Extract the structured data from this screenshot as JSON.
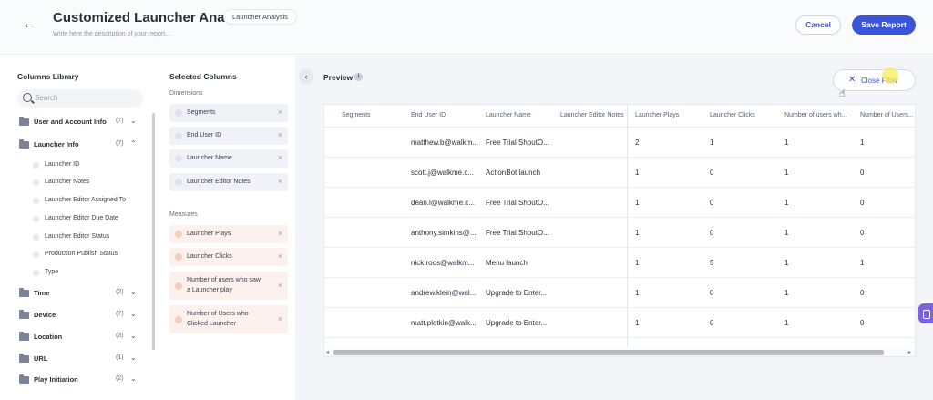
{
  "header": {
    "title": "Customized Launcher Analysis",
    "badge": "Launcher Analysis",
    "description_placeholder": "Write here the description of your report...",
    "cancel_label": "Cancel",
    "save_label": "Save Report",
    "accent_color": "#3b55d9"
  },
  "library": {
    "title": "Columns Library",
    "search_placeholder": "Search",
    "categories": [
      {
        "label": "User and Account Info",
        "count": "(7)",
        "chevron": "⌄"
      },
      {
        "label": "Launcher Info",
        "count": "(7)",
        "chevron": "⌃"
      },
      {
        "label": "Time",
        "count": "(2)",
        "chevron": "⌄"
      },
      {
        "label": "Device",
        "count": "(7)",
        "chevron": "⌄"
      },
      {
        "label": "Location",
        "count": "(3)",
        "chevron": "⌄"
      },
      {
        "label": "URL",
        "count": "(1)",
        "chevron": "⌄"
      },
      {
        "label": "Play Initiation",
        "count": "(2)",
        "chevron": "⌄"
      }
    ],
    "launcher_info_items": [
      "Launcher ID",
      "Launcher Notes",
      "Launcher Editor Assigned To",
      "Launcher Editor Due Date",
      "Launcher Editor Status",
      "Production Publish Status",
      "Type"
    ]
  },
  "selected": {
    "title": "Selected Columns",
    "dimensions_label": "Dimensions",
    "measures_label": "Measures",
    "dimensions": [
      "Segments",
      "End User ID",
      "Launcher Name",
      "Launcher Editor Notes"
    ],
    "measures": [
      {
        "line1": "Launcher Plays",
        "line2": ""
      },
      {
        "line1": "Launcher Clicks",
        "line2": ""
      },
      {
        "line1": "Number of users who saw",
        "line2": "a Launcher play"
      },
      {
        "line1": "Number of Users who",
        "line2": "Clicked Launcher"
      }
    ],
    "remove_icon": "×"
  },
  "preview": {
    "title": "Preview",
    "info_icon": "i",
    "close_filter_label": "Close Filter",
    "columns": [
      "Segments",
      "End User ID",
      "Launcher Name",
      "Launcher Editor Notes",
      "Launcher Plays",
      "Launcher Clicks",
      "Number of users wh...",
      "Number of Users..."
    ],
    "rows": [
      [
        "",
        "matthew.b@walkm...",
        "Free Trial ShoutO...",
        "",
        "2",
        "1",
        "1",
        "1"
      ],
      [
        "",
        "scott.j@walkme.c...",
        "ActionBot launch",
        "",
        "1",
        "0",
        "1",
        "0"
      ],
      [
        "",
        "dean.l@walkme.c...",
        "Free Trial ShoutO...",
        "",
        "1",
        "0",
        "1",
        "0"
      ],
      [
        "",
        "anthony.simkins@...",
        "Free Trial ShoutO...",
        "",
        "1",
        "0",
        "1",
        "0"
      ],
      [
        "",
        "nick.roos@walkm...",
        "Menu launch",
        "",
        "1",
        "5",
        "1",
        "1"
      ],
      [
        "",
        "andrew.klein@wal...",
        "Upgrade to Enter...",
        "",
        "1",
        "0",
        "1",
        "0"
      ],
      [
        "",
        "matt.plotkin@walk...",
        "Upgrade to Enter...",
        "",
        "1",
        "0",
        "1",
        "0"
      ]
    ]
  }
}
